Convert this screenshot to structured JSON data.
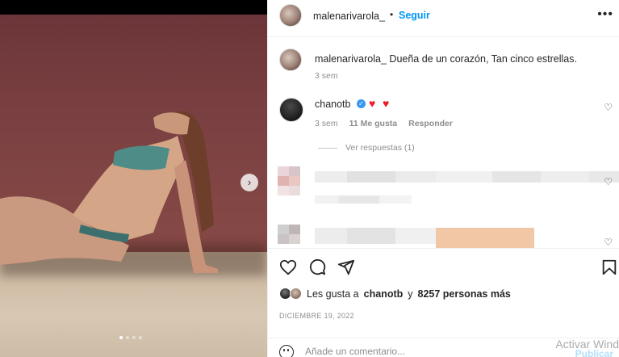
{
  "post": {
    "username": "malenarivarola_",
    "follow_label": "Seguir",
    "more_label": "•••",
    "carousel_next": "›",
    "carousel_dots": 4,
    "carousel_active": 0
  },
  "caption": {
    "username": "malenarivarola_",
    "text": "Dueña de un corazón, Tan cinco estrellas.",
    "time": "3 sem"
  },
  "comments": [
    {
      "username": "chanotb",
      "verified": true,
      "text": "❤️❤️",
      "time": "3 sem",
      "likes": "11 Me gusta",
      "reply_label": "Responder",
      "view_replies": "Ver respuestas (1)"
    }
  ],
  "footer": {
    "likes_prefix": "Les gusta a",
    "likes_user": "chanotb",
    "likes_joiner": "y",
    "likes_others": "8257 personas más",
    "date": "DICIEMBRE 19, 2022",
    "comment_placeholder": "Añade un comentario...",
    "publish_label": "Publicar",
    "watermark": "Activar Wind"
  },
  "colors": {
    "link": "#0095f6",
    "heart": "#ed1c2b",
    "muted": "#8e8e8e",
    "verified": "#3897f0"
  },
  "icons": [
    "like-icon",
    "comment-icon",
    "share-icon",
    "save-icon",
    "emoji-icon",
    "more-icon",
    "chevron-right-icon"
  ]
}
